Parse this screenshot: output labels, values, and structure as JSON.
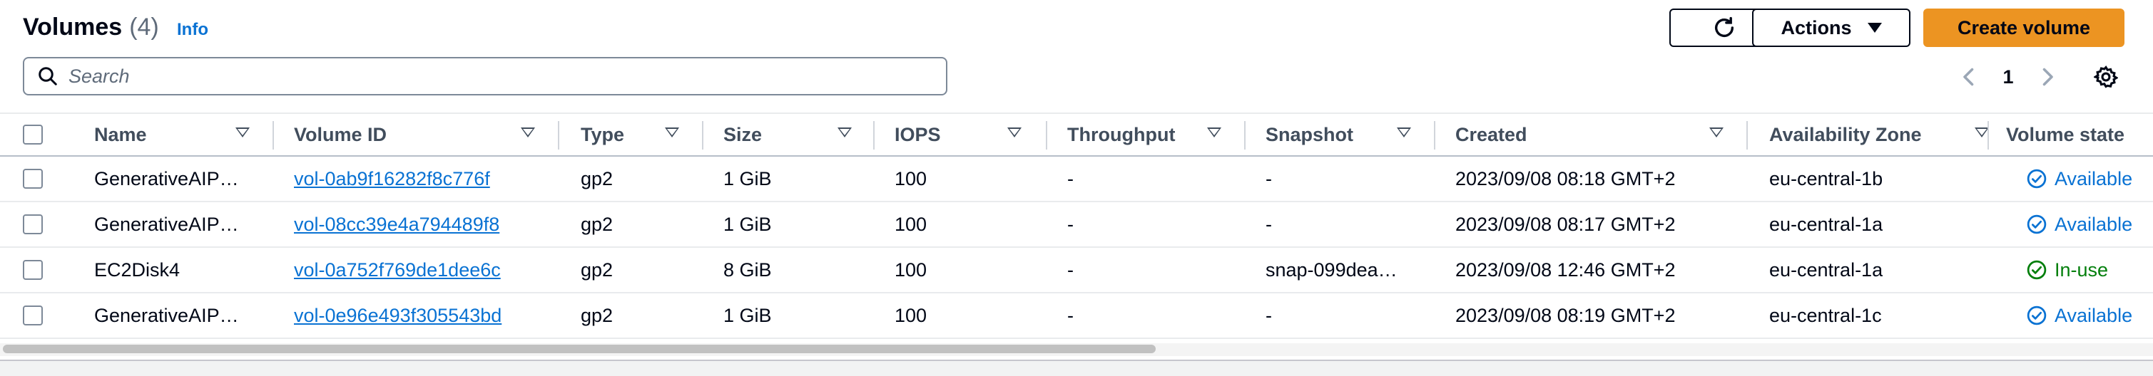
{
  "header": {
    "title": "Volumes",
    "count": "(4)",
    "info": "Info",
    "actions_label": "Actions",
    "create_label": "Create volume"
  },
  "search": {
    "placeholder": "Search"
  },
  "pagination": {
    "current": "1"
  },
  "columns": [
    "Name",
    "Volume ID",
    "Type",
    "Size",
    "IOPS",
    "Throughput",
    "Snapshot",
    "Created",
    "Availability Zone",
    "Volume state"
  ],
  "rows": [
    {
      "name": "GenerativeAIP…",
      "volume_id": "vol-0ab9f16282f8c776f",
      "type": "gp2",
      "size": "1 GiB",
      "iops": "100",
      "throughput": "-",
      "snapshot": "-",
      "created": "2023/09/08 08:18 GMT+2",
      "az": "eu-central-1b",
      "state": "Available"
    },
    {
      "name": "GenerativeAIP…",
      "volume_id": "vol-08cc39e4a794489f8",
      "type": "gp2",
      "size": "1 GiB",
      "iops": "100",
      "throughput": "-",
      "snapshot": "-",
      "created": "2023/09/08 08:17 GMT+2",
      "az": "eu-central-1a",
      "state": "Available"
    },
    {
      "name": "EC2Disk4",
      "volume_id": "vol-0a752f769de1dee6c",
      "type": "gp2",
      "size": "8 GiB",
      "iops": "100",
      "throughput": "-",
      "snapshot": "snap-099dea…",
      "created": "2023/09/08 12:46 GMT+2",
      "az": "eu-central-1a",
      "state": "In-use"
    },
    {
      "name": "GenerativeAIP…",
      "volume_id": "vol-0e96e493f305543bd",
      "type": "gp2",
      "size": "1 GiB",
      "iops": "100",
      "throughput": "-",
      "snapshot": "-",
      "created": "2023/09/08 08:19 GMT+2",
      "az": "eu-central-1c",
      "state": "Available"
    }
  ],
  "colors": {
    "primary_button": "#ec9422",
    "link": "#0972d3",
    "available": "#0972d3",
    "in_use": "#037f0c"
  },
  "icons": [
    "refresh-icon",
    "caret-down-icon",
    "search-icon",
    "chevron-left-icon",
    "chevron-right-icon",
    "settings-gear-icon",
    "sort-icon",
    "status-info-icon",
    "status-success-icon"
  ]
}
